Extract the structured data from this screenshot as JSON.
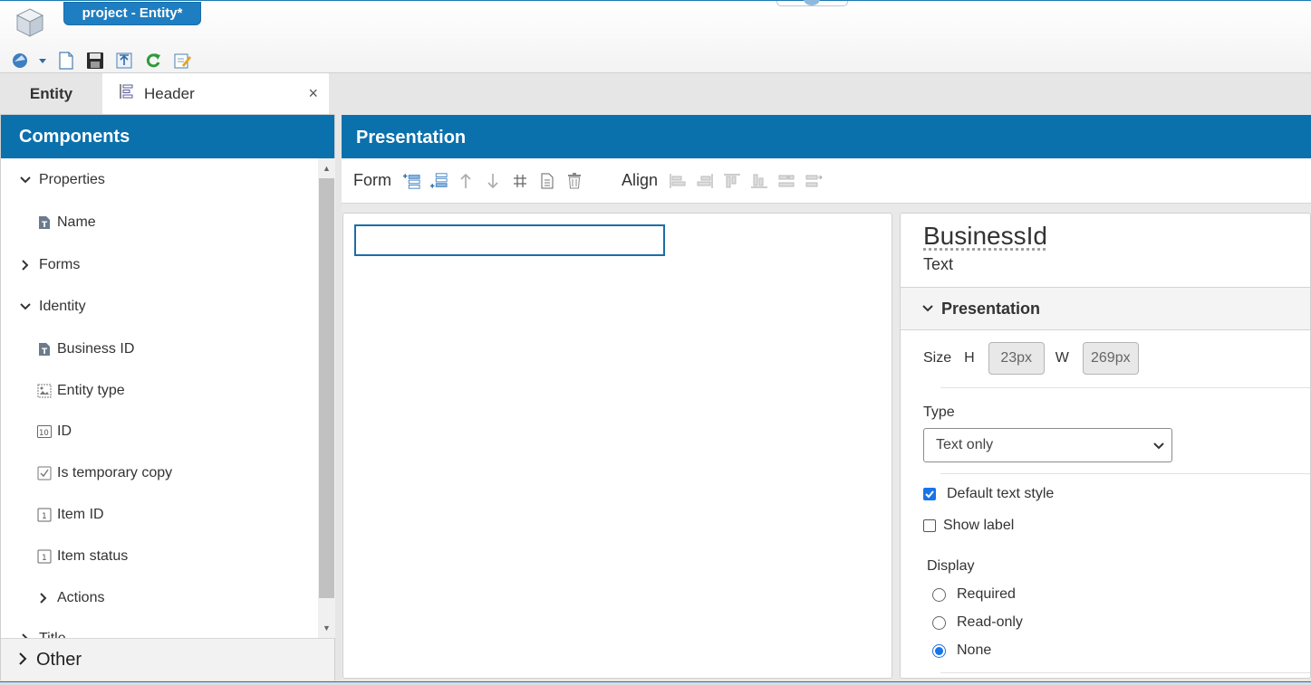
{
  "window": {
    "title": "project - Entity*"
  },
  "toolbar": {
    "buttons": [
      "publish-dropdown-icon",
      "new-document-icon",
      "save-icon",
      "export-icon",
      "refresh-icon",
      "edit-icon"
    ]
  },
  "tabs": [
    {
      "label": "Entity",
      "active": false
    },
    {
      "label": "Header",
      "active": true,
      "closable": true,
      "close_glyph": "×"
    }
  ],
  "components": {
    "title": "Components",
    "items": [
      {
        "label": "Properties",
        "type": "group",
        "expanded": true
      },
      {
        "label": "Name",
        "type": "text-field"
      },
      {
        "label": "Forms",
        "type": "group",
        "expanded": false
      },
      {
        "label": "Identity",
        "type": "group",
        "expanded": true
      },
      {
        "label": "Business ID",
        "type": "text-field"
      },
      {
        "label": "Entity type",
        "type": "image-field"
      },
      {
        "label": "ID",
        "type": "number-field"
      },
      {
        "label": "Is temporary copy",
        "type": "checkbox-field"
      },
      {
        "label": "Item ID",
        "type": "integer-field"
      },
      {
        "label": "Item status",
        "type": "integer-field"
      },
      {
        "label": "Actions",
        "type": "group",
        "expanded": false
      },
      {
        "label": "Title",
        "type": "group",
        "expanded": false
      }
    ],
    "other": "Other"
  },
  "presentation": {
    "title": "Presentation",
    "form_label": "Form",
    "align_label": "Align"
  },
  "properties_panel": {
    "name": "BusinessId",
    "type": "Text",
    "section": "Presentation",
    "size_label": "Size",
    "h_label": "H",
    "w_label": "W",
    "height_value": "23px",
    "width_value": "269px",
    "type_label": "Type",
    "type_value": "Text only",
    "default_text_style": {
      "label": "Default text style",
      "checked": true
    },
    "show_label": {
      "label": "Show label",
      "checked": false
    },
    "display_label": "Display",
    "display_options": [
      {
        "label": "Required",
        "checked": false
      },
      {
        "label": "Read-only",
        "checked": false
      },
      {
        "label": "None",
        "checked": true
      }
    ]
  },
  "colors": {
    "accent": "#0a71ad",
    "checkbox": "#1a73e8"
  }
}
